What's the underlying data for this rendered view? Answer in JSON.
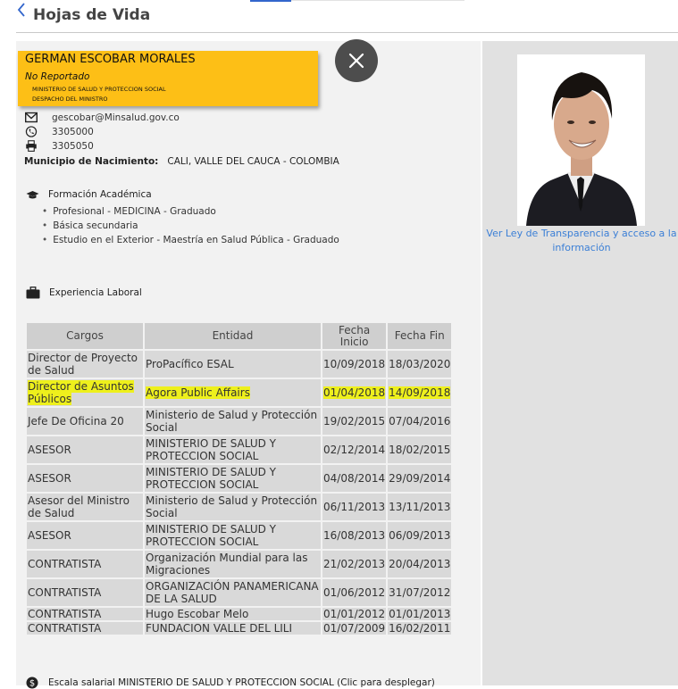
{
  "header": {
    "title": "Hojas de Vida",
    "back_icon": "chevron-left-icon"
  },
  "profile": {
    "name": "GERMAN ESCOBAR MORALES",
    "status": "No Reportado",
    "org_line1": "MINISTERIO DE SALUD Y PROTECCION SOCIAL",
    "org_line2": "DESPACHO DEL MINISTRO",
    "card_color": "#fdbf16"
  },
  "contact": {
    "email": "gescobar@Minsalud.gov.co",
    "phone": "3305000",
    "fax": "3305050",
    "birth_label": "Municipio de Nacimiento:",
    "birth_value": "CALI, VALLE DEL CAUCA - COLOMBIA"
  },
  "education": {
    "title": "Formación Académica",
    "items": [
      "Profesional - MEDICINA - Graduado",
      "Básica secundaria",
      "Estudio en el Exterior - Maestría en Salud Pública - Graduado"
    ]
  },
  "experience": {
    "title": "Experiencia Laboral",
    "headers": [
      "Cargos",
      "Entidad",
      "Fecha Inicio",
      "Fecha Fin"
    ],
    "rows": [
      [
        "Director de Proyecto de Salud",
        "ProPacífico ESAL",
        "10/09/2018",
        "18/03/2020"
      ],
      [
        "Director de Asuntos Públicos",
        "Agora Public Affairs",
        "01/04/2018",
        "14/09/2018"
      ],
      [
        "Jefe De Oficina 20",
        "Ministerio de Salud y Protección Social",
        "19/02/2015",
        "07/04/2016"
      ],
      [
        "ASESOR",
        "MINISTERIO DE SALUD Y PROTECCION SOCIAL",
        "02/12/2014",
        "18/02/2015"
      ],
      [
        "ASESOR",
        "MINISTERIO DE SALUD Y PROTECCION SOCIAL",
        "04/08/2014",
        "29/09/2014"
      ],
      [
        "Asesor del Ministro de Salud",
        "Ministerio de Salud y Protección Social",
        "06/11/2013",
        "13/11/2013"
      ],
      [
        "ASESOR",
        "MINISTERIO DE SALUD Y PROTECCION SOCIAL",
        "16/08/2013",
        "06/09/2013"
      ],
      [
        "CONTRATISTA",
        "Organización Mundial para las Migraciones",
        "21/02/2013",
        "20/04/2013"
      ],
      [
        "CONTRATISTA",
        "ORGANIZACIÓN PANAMERICANA DE LA SALUD",
        "01/06/2012",
        "31/07/2012"
      ],
      [
        "CONTRATISTA",
        "Hugo Escobar Melo",
        "01/01/2012",
        "01/01/2013"
      ],
      [
        "CONTRATISTA",
        "FUNDACION VALLE DEL LILI",
        "01/07/2009",
        "16/02/2011"
      ]
    ],
    "highlight_color": "#eef01c"
  },
  "salary": {
    "text": "Escala salarial MINISTERIO DE SALUD Y PROTECCION SOCIAL (Clic para desplegar)"
  },
  "sidebar": {
    "transparency_link": "Ver Ley de Transparencia y acceso a la información"
  }
}
